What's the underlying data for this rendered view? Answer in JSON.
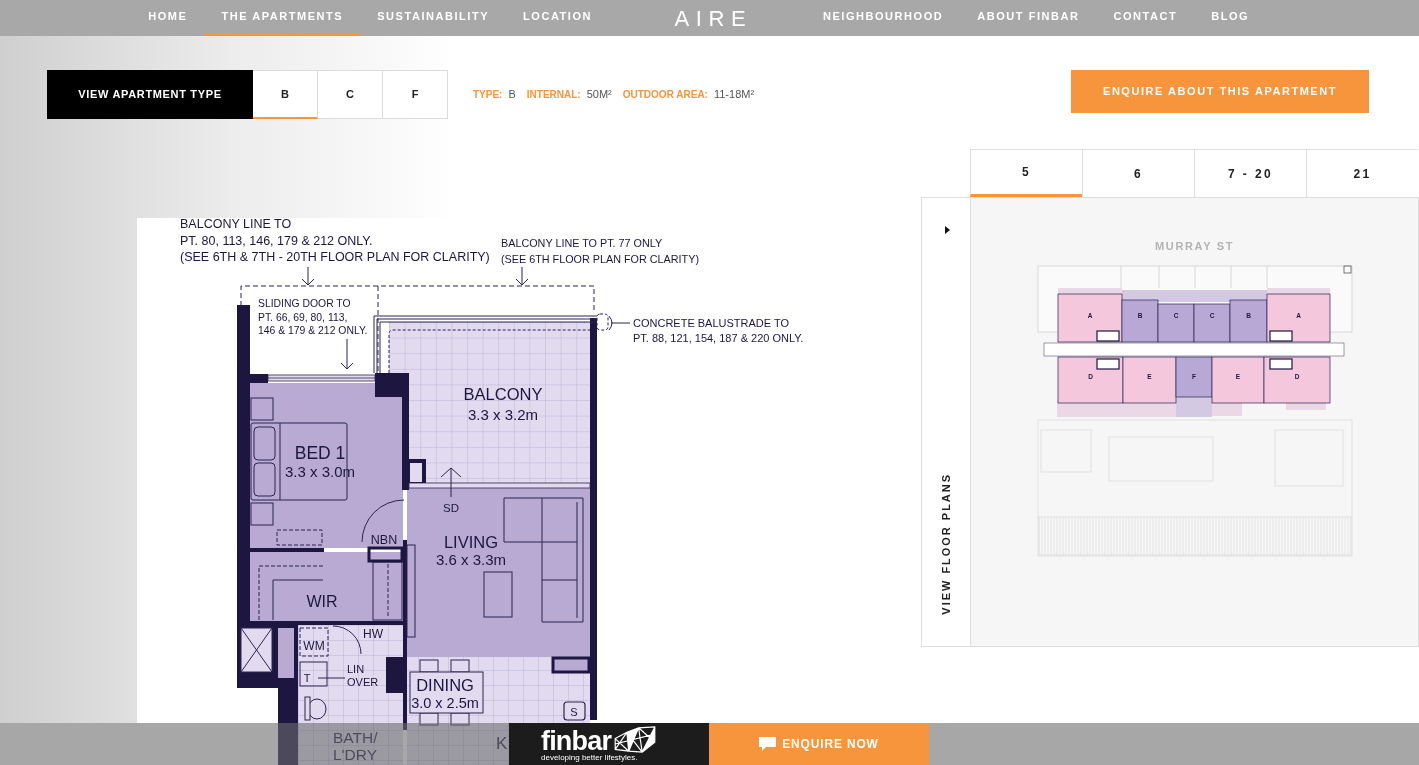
{
  "nav": {
    "left_links": [
      {
        "label": "HOME",
        "selected": false
      },
      {
        "label": "THE APARTMENTS",
        "selected": true
      },
      {
        "label": "SUSTAINABILITY",
        "selected": false
      },
      {
        "label": "LOCATION",
        "selected": false
      }
    ],
    "logo": "AIRE",
    "right_links": [
      {
        "label": "NEIGHBOURHOOD",
        "selected": false
      },
      {
        "label": "ABOUT FINBAR",
        "selected": false
      },
      {
        "label": "CONTACT",
        "selected": false
      },
      {
        "label": "BLOG",
        "selected": false
      }
    ]
  },
  "apartment_type": {
    "label": "VIEW APARTMENT TYPE",
    "tabs": [
      {
        "label": "B",
        "selected": true
      },
      {
        "label": "C",
        "selected": false
      },
      {
        "label": "F",
        "selected": false
      }
    ],
    "details": [
      {
        "label": "TYPE:",
        "value": "B"
      },
      {
        "label": "INTERNAL:",
        "value": "50M²"
      },
      {
        "label": "OUTDOOR AREA:",
        "value": "11-18M²"
      }
    ]
  },
  "enquire_button": "ENQUIRE ABOUT THIS APARTMENT",
  "floor_plan": {
    "annotations": [
      {
        "lines": [
          "BALCONY LINE TO",
          "PT. 80, 113, 146, 179 & 212 ONLY.",
          "(SEE 6TH & 7TH - 20TH FLOOR PLAN FOR CLARITY)"
        ]
      },
      {
        "lines": [
          "BALCONY LINE TO PT. 77 ONLY",
          "(SEE 6TH FLOOR PLAN FOR CLARITY)"
        ]
      },
      {
        "lines": [
          "SLIDING DOOR TO",
          "PT. 66, 69, 80, 113,",
          "146 & 179 & 212 ONLY."
        ]
      },
      {
        "lines": [
          "CONCRETE BALUSTRADE TO",
          "PT. 88, 121, 154, 187 & 220 ONLY."
        ]
      }
    ],
    "rooms": [
      {
        "lines": [
          "BALCONY"
        ],
        "size": "3.3 x 3.2m"
      },
      {
        "lines": [
          "BED 1"
        ],
        "size": "3.3 x 3.0m"
      },
      {
        "lines": [
          "LIVING"
        ],
        "size": "3.6 x 3.3m"
      },
      {
        "lines": [
          "WIR"
        ]
      },
      {
        "lines": [
          "DINING"
        ],
        "size": "3.0 x 2.5m"
      },
      {
        "lines": [
          "BATH/",
          "L'DRY"
        ]
      },
      {
        "lines": [
          "K"
        ]
      }
    ],
    "fixture_labels": [
      {
        "lines": [
          "SD"
        ]
      },
      {
        "lines": [
          "NBN"
        ]
      },
      {
        "lines": [
          "HW"
        ]
      },
      {
        "lines": [
          "WM"
        ]
      },
      {
        "lines": [
          "T"
        ]
      },
      {
        "lines": [
          "LIN",
          "OVER"
        ]
      },
      {
        "lines": [
          "S"
        ]
      }
    ]
  },
  "floor_plans_panel": {
    "tabs": [
      {
        "label": "5",
        "selected": true
      },
      {
        "label": "6",
        "selected": false
      },
      {
        "label": "7 - 20",
        "selected": false
      },
      {
        "label": "21",
        "selected": false
      }
    ],
    "toggle_label": "VIEW FLOOR PLANS",
    "street": "MURRAY ST",
    "units": [
      {
        "label": "A",
        "color": "#f4c7dc"
      },
      {
        "label": "B",
        "color": "#b8a8d5"
      },
      {
        "label": "C",
        "color": "#b8a8d5"
      },
      {
        "label": "C",
        "color": "#b8a8d5"
      },
      {
        "label": "B",
        "color": "#b8a8d5"
      },
      {
        "label": "A",
        "color": "#f4c7dc"
      },
      {
        "label": "D",
        "color": "#f4c7dc"
      },
      {
        "label": "E",
        "color": "#f4c7dc"
      },
      {
        "label": "F",
        "color": "#b8a8d5"
      },
      {
        "label": "E",
        "color": "#f4c7dc"
      },
      {
        "label": "D",
        "color": "#f4c7dc"
      }
    ]
  },
  "footer": {
    "brand": "finbar",
    "tagline": "developing better lifestyles.",
    "button": "ENQUIRE NOW"
  }
}
